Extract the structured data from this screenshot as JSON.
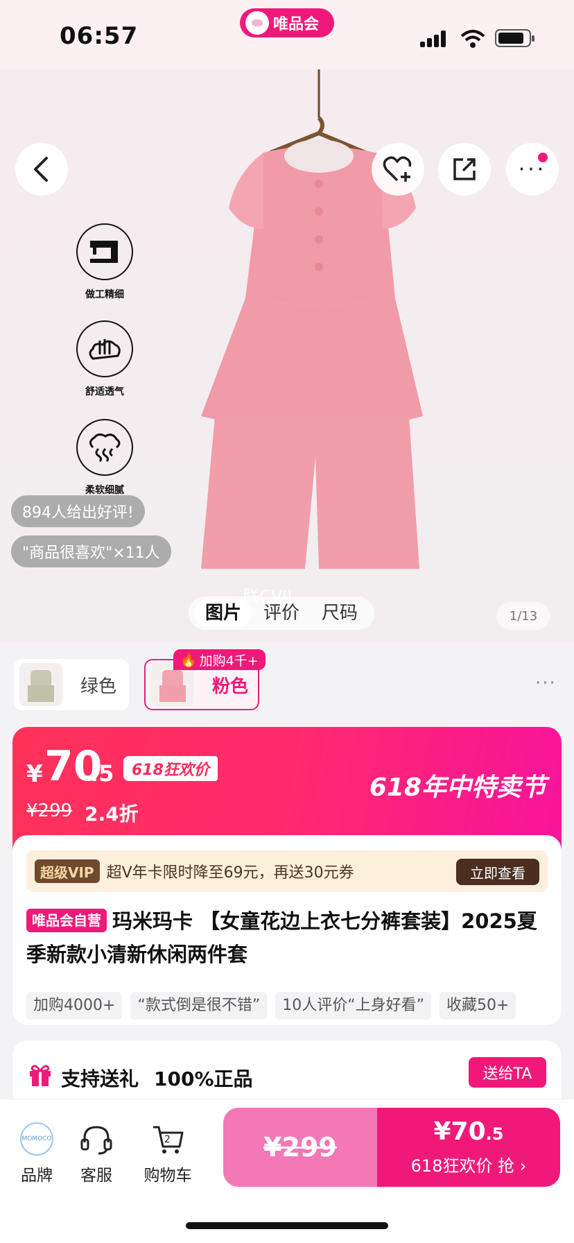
{
  "status_bar": {
    "time": "06:57",
    "app_badge": "唯品会"
  },
  "hero": {
    "features": [
      {
        "label": "做工精细",
        "icon": "sewing-machine-icon"
      },
      {
        "label": "舒适透气",
        "icon": "breathable-icon"
      },
      {
        "label": "柔软细腻",
        "icon": "soft-cloud-icon"
      }
    ],
    "review_chips": [
      "894人给出好评!",
      "\"商品很喜欢\"×11人"
    ],
    "tabs": [
      "图片",
      "评价",
      "尺码"
    ],
    "active_tab": "图片",
    "image_counter": "1/13",
    "watermark": "朕CVII"
  },
  "variants": {
    "items": [
      {
        "name": "绿色",
        "selected": false
      },
      {
        "name": "粉色",
        "selected": true
      }
    ],
    "badge": "加购4千+"
  },
  "price": {
    "yen": "¥",
    "main": "70",
    "decimal": ".5",
    "promo_tag": "618狂欢价",
    "original": "¥299",
    "discount": "2.4折",
    "festival": "618年中特卖节"
  },
  "vip": {
    "tag": "超级VIP",
    "text": "超V年卡限时降至69元，再送30元券",
    "button": "立即查看"
  },
  "product": {
    "self_tag": "唯品会自营",
    "title": "玛米玛卡 【女童花边上衣七分裤套装】2025夏季新款小清新休闲两件套",
    "chips": [
      "加购4000+",
      "“款式倒是很不错”",
      "10人评价“上身好看”",
      "收藏50+"
    ]
  },
  "gift": {
    "text": "支持送礼",
    "authentic": "100%正品",
    "button": "送给TA"
  },
  "bottom": {
    "nav": [
      {
        "label": "品牌",
        "icon": "brand-logo-icon"
      },
      {
        "label": "客服",
        "icon": "headset-icon"
      },
      {
        "label": "购物车",
        "icon": "cart-icon",
        "count": "2"
      }
    ],
    "orig_price": "¥299",
    "buy_price": "¥70",
    "buy_decimal": ".5",
    "buy_sub": "618狂欢价 抢 ›"
  },
  "colors": {
    "accent": "#f0197a",
    "band_start": "#ff3158",
    "band_end": "#f7139b",
    "product_pink": "#f19aa8"
  }
}
